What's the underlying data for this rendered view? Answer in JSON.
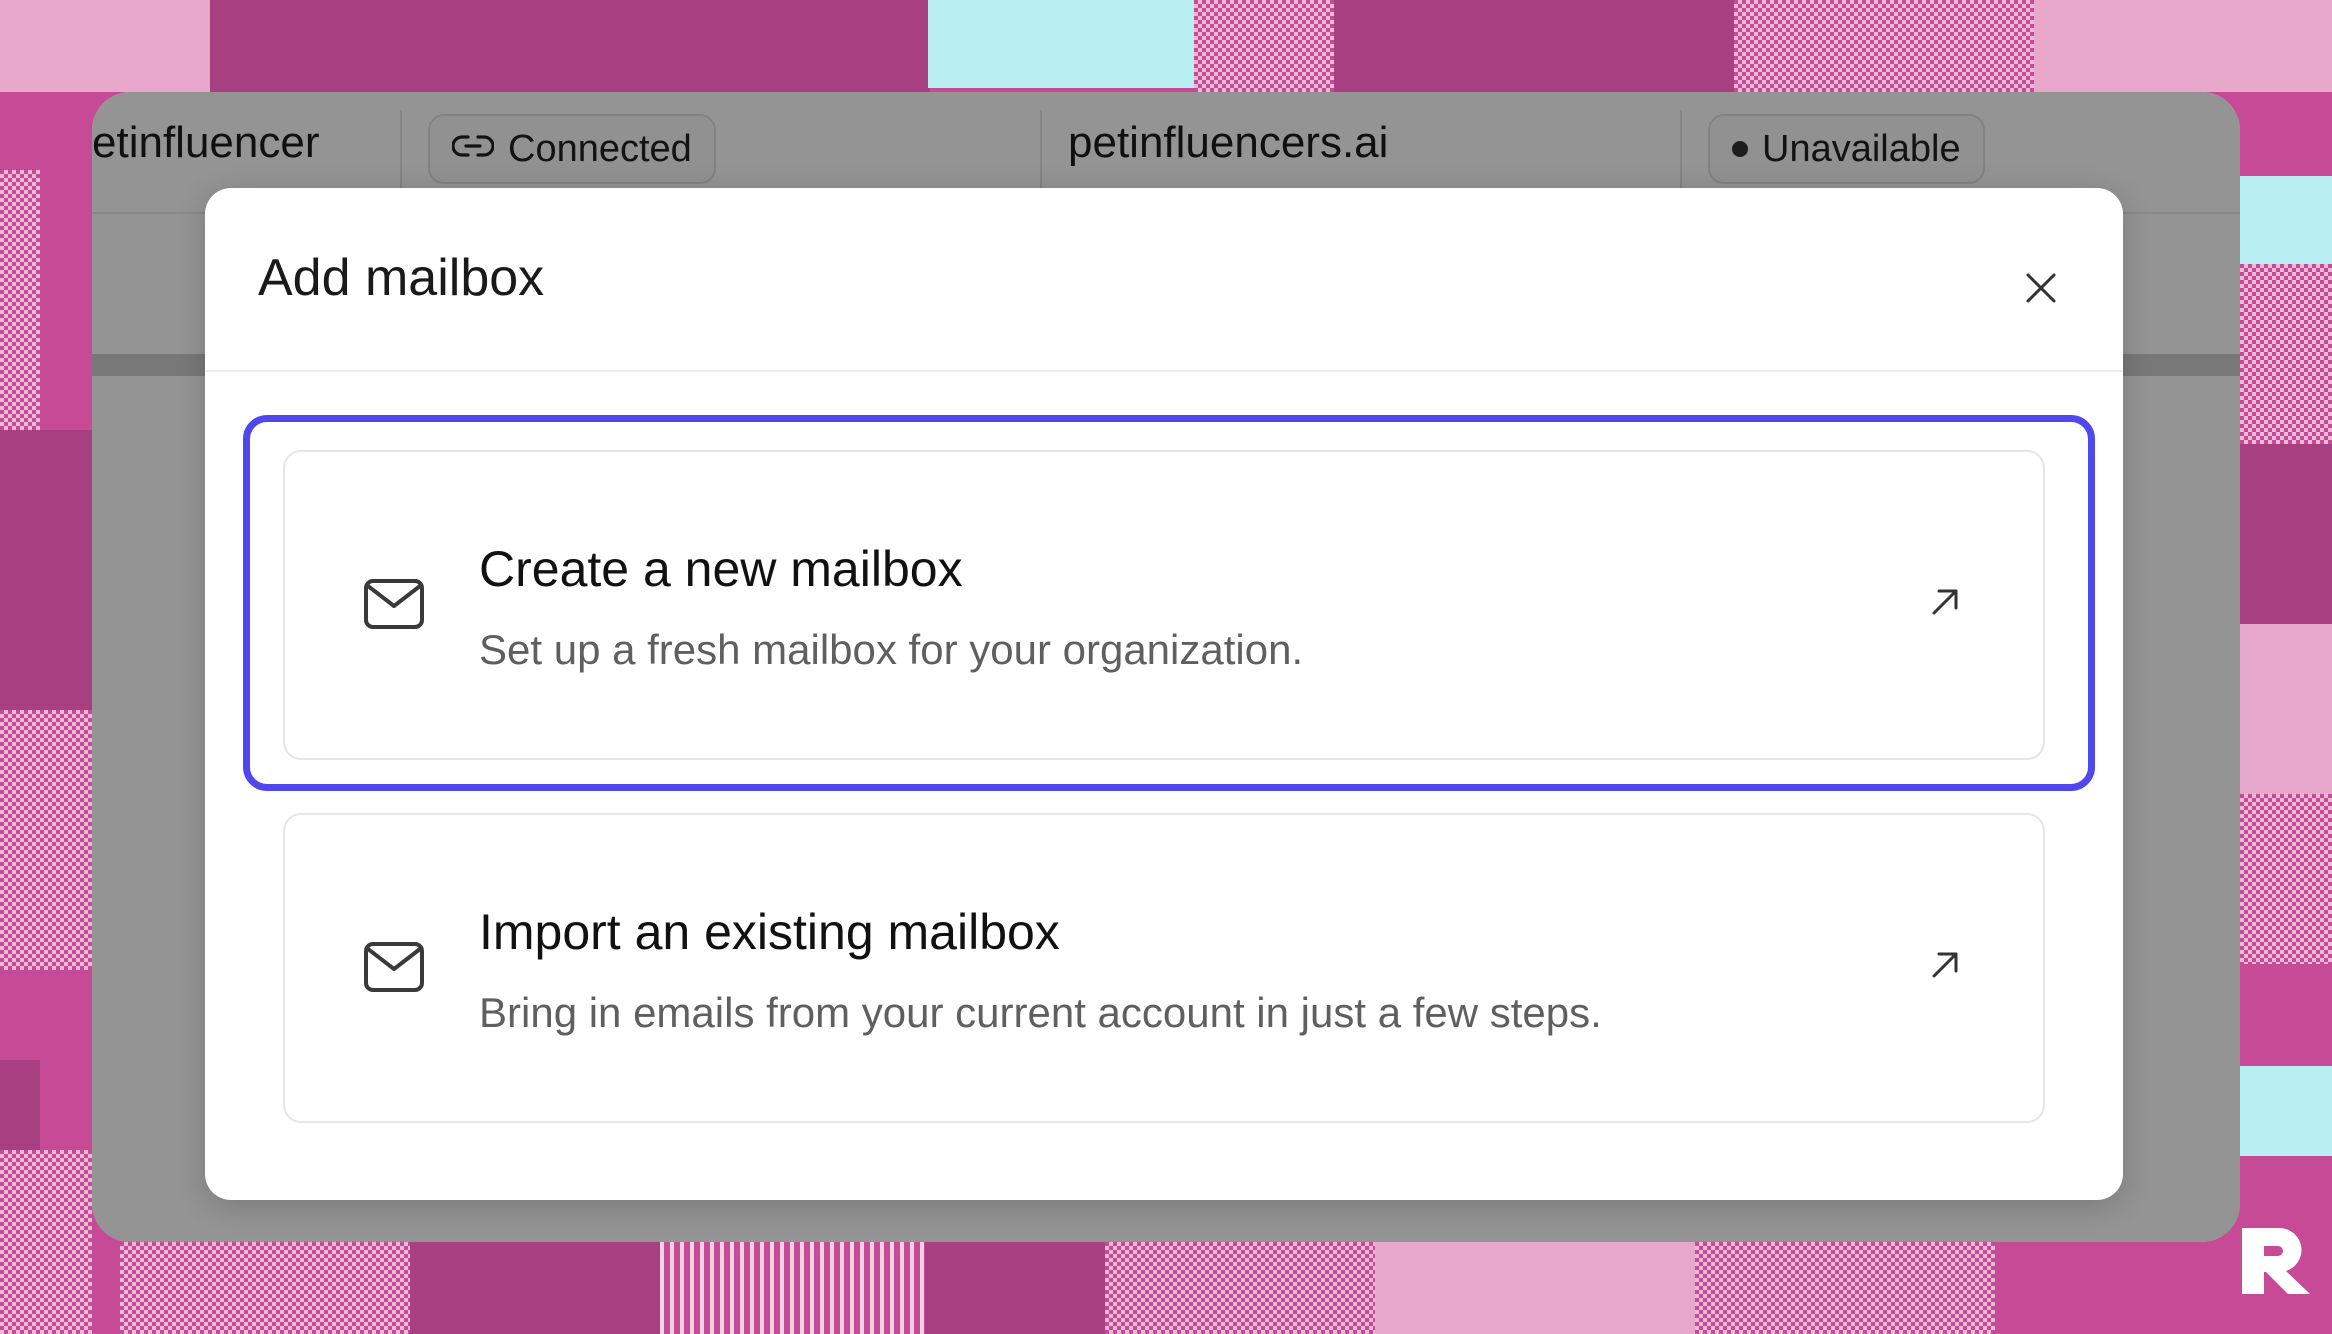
{
  "background": {
    "logo_icon": "r-logo-icon"
  },
  "app": {
    "row": {
      "name": "etinfluencer",
      "connection_status": "Connected",
      "connection_icon": "link-icon",
      "domain": "petinfluencers.ai",
      "availability_status": "Unavailable"
    }
  },
  "modal": {
    "title": "Add mailbox",
    "close_icon": "close-icon",
    "options": [
      {
        "title": "Create a new mailbox",
        "description": "Set up a fresh mailbox for your organization.",
        "icon": "mail-icon",
        "action_icon": "arrow-up-right-icon",
        "focused": true
      },
      {
        "title": "Import an existing mailbox",
        "description": "Bring in emails from your current account in just a few steps.",
        "icon": "mail-icon",
        "action_icon": "arrow-up-right-icon",
        "focused": false
      }
    ]
  },
  "colors": {
    "focus_ring": "#4f48ec",
    "background_pink": "#c64a96",
    "overlay": "rgba(0,0,0,0.42)"
  }
}
